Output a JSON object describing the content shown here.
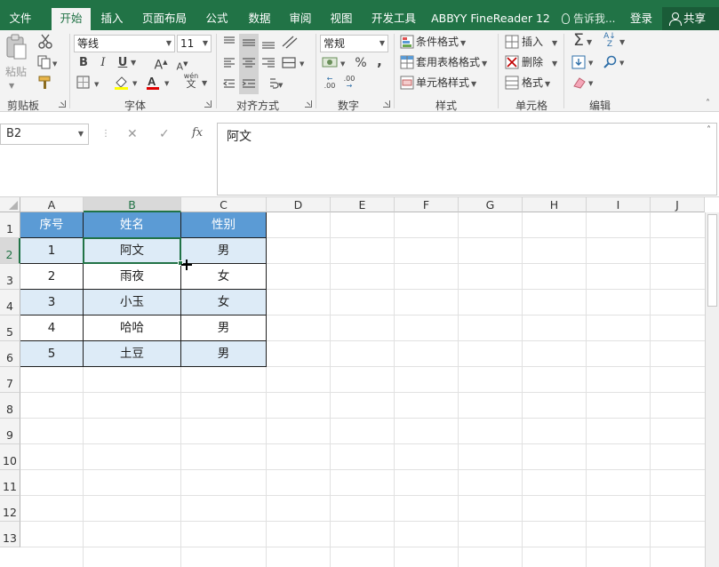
{
  "tabs": [
    {
      "label": "文件",
      "active": false
    },
    {
      "label": "开始",
      "active": true
    },
    {
      "label": "插入",
      "active": false
    },
    {
      "label": "页面布局",
      "active": false
    },
    {
      "label": "公式",
      "active": false
    },
    {
      "label": "数据",
      "active": false
    },
    {
      "label": "审阅",
      "active": false
    },
    {
      "label": "视图",
      "active": false
    },
    {
      "label": "开发工具",
      "active": false
    },
    {
      "label": "ABBYY FineReader 12",
      "active": false
    }
  ],
  "tell_me": "告诉我...",
  "login": "登录",
  "share": "共享",
  "ribbon": {
    "clipboard": {
      "paste": "粘贴",
      "label": "剪贴板"
    },
    "font": {
      "name": "等线",
      "size": "11",
      "label": "字体",
      "bold": "B",
      "italic": "I",
      "underline": "U",
      "grow": "A",
      "shrink": "A",
      "phonetic_top": "wén",
      "phonetic_bottom": "文"
    },
    "alignment": {
      "label": "对齐方式"
    },
    "number": {
      "format": "常规",
      "percent": "%",
      "comma": ",",
      "inc_decimal": ".00",
      "dec_decimal": ".00",
      "label": "数字"
    },
    "styles": {
      "conditional": "条件格式",
      "table": "套用表格格式",
      "cell_styles": "单元格样式",
      "label": "样式"
    },
    "cells": {
      "insert": "插入",
      "delete": "删除",
      "format": "格式",
      "label": "单元格"
    },
    "editing": {
      "label": "编辑"
    }
  },
  "colors": {
    "accent": "#217346",
    "header_fill": "#5b9bd5",
    "band_fill": "#ddebf7",
    "font_red": "#e00000",
    "highlight_yellow": "#ffff00"
  },
  "formula_bar": {
    "name_box": "B2",
    "cancel": "✕",
    "enter": "✓",
    "fx": "fx",
    "content": "阿文"
  },
  "columns": [
    "A",
    "B",
    "C",
    "D",
    "E",
    "F",
    "G",
    "H",
    "I",
    "J"
  ],
  "rows": [
    "1",
    "2",
    "3",
    "4",
    "5",
    "6",
    "7",
    "8",
    "9",
    "10",
    "11",
    "12",
    "13"
  ],
  "table": {
    "headers": [
      "序号",
      "姓名",
      "性别"
    ],
    "rows": [
      [
        "1",
        "阿文",
        "男"
      ],
      [
        "2",
        "雨夜",
        "女"
      ],
      [
        "3",
        "小玉",
        "女"
      ],
      [
        "4",
        "哈哈",
        "男"
      ],
      [
        "5",
        "土豆",
        "男"
      ]
    ]
  },
  "selected_cell": "B2"
}
